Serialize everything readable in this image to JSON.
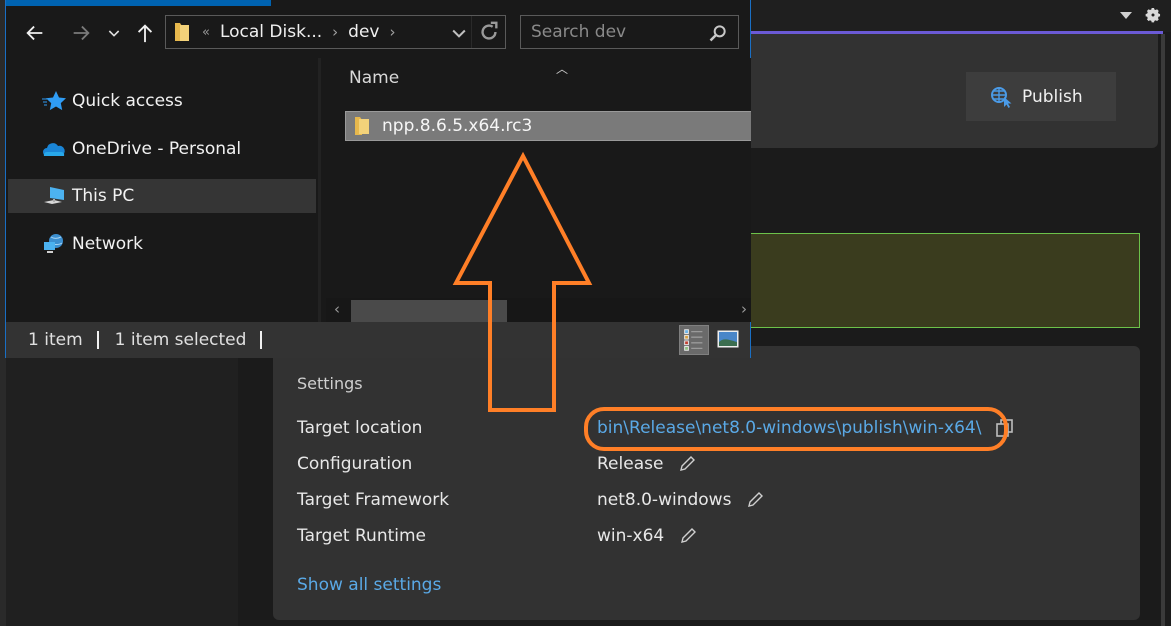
{
  "explorer": {
    "nav_buttons": {
      "back": "back-arrow",
      "forward": "forward-arrow",
      "recent": "chevron-down",
      "up": "up-arrow"
    },
    "address_bar": {
      "overflow_indicator": "«",
      "breadcrumbs": [
        "Local Disk...",
        "dev"
      ]
    },
    "search": {
      "placeholder": "Search dev",
      "value": ""
    },
    "nav_pane": {
      "items": [
        {
          "label": "Quick access",
          "icon": "star-icon",
          "selected": false
        },
        {
          "label": "OneDrive - Personal",
          "icon": "cloud-icon",
          "selected": false
        },
        {
          "label": "This PC",
          "icon": "computer-icon",
          "selected": true
        },
        {
          "label": "Network",
          "icon": "network-icon",
          "selected": false
        }
      ]
    },
    "content": {
      "column_header": "Name",
      "files": [
        {
          "name": "npp.8.6.5.x64.rc3",
          "type": "folder",
          "selected": true
        }
      ]
    },
    "status_bar": {
      "item_count": "1 item",
      "selection": "1 item selected"
    }
  },
  "publish_page": {
    "publish_button_label": "Publish",
    "settings": {
      "title": "Settings",
      "rows": [
        {
          "label": "Target location",
          "value": "bin\\Release\\net8.0-windows\\publish\\win-x64\\",
          "action": "copy"
        },
        {
          "label": "Configuration",
          "value": "Release",
          "action": "edit"
        },
        {
          "label": "Target Framework",
          "value": "net8.0-windows",
          "action": "edit"
        },
        {
          "label": "Target Runtime",
          "value": "win-x64",
          "action": "edit"
        }
      ],
      "show_all_link": "Show all settings"
    }
  },
  "annotations": {
    "color": "#ff7f27",
    "arrow": "up-arrow pointing from target location to selected folder",
    "highlight": "ellipse around target location value"
  },
  "colors": {
    "accent_line": "#6b5ad6",
    "link": "#5aa9e6",
    "success_border": "#6cc24a",
    "explorer_border": "#1a6fc4"
  }
}
